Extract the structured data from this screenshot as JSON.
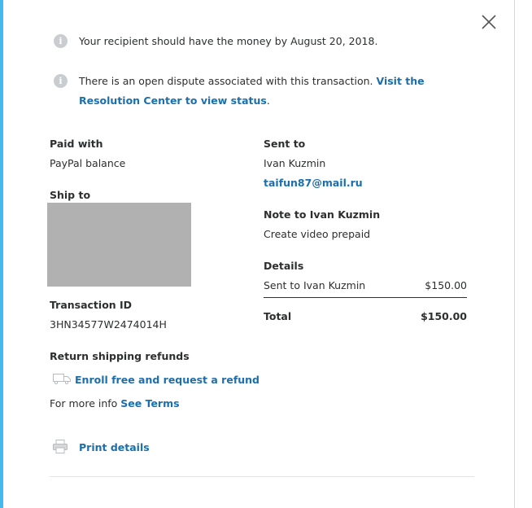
{
  "notices": [
    {
      "text": "Your recipient should have the money by August 20, 2018.",
      "link": ""
    },
    {
      "text": "There is an open dispute associated with this transaction. ",
      "link": "Visit the Resolution Center to view status",
      "suffix": "."
    }
  ],
  "paid_with": {
    "label": "Paid with",
    "value": "PayPal balance"
  },
  "ship_to": {
    "label": "Ship to"
  },
  "transaction": {
    "label": "Transaction ID",
    "value": "3HN34577W2474014H"
  },
  "return_shipping": {
    "label": "Return shipping refunds",
    "enroll_link": "Enroll free and request a refund",
    "more_info_prefix": "For more info ",
    "terms_link": "See Terms"
  },
  "print": {
    "label": "Print details"
  },
  "sent_to": {
    "label": "Sent to",
    "name": "Ivan Kuzmin",
    "email": "taifun87@mail.ru"
  },
  "note": {
    "label": "Note to Ivan Kuzmin",
    "value": "Create video prepaid"
  },
  "details": {
    "label": "Details",
    "line_label": "Sent to Ivan Kuzmin",
    "line_amount": "$150.00",
    "total_label": "Total",
    "total_amount": "$150.00"
  },
  "icons": {
    "close": "close-icon",
    "info": "info-icon",
    "truck": "truck-icon",
    "printer": "printer-icon"
  },
  "colors": {
    "accent_bar": "#44b8ef",
    "link": "#1b6fac",
    "text": "#2c2e2f",
    "redacted": "#b1b1b1"
  }
}
